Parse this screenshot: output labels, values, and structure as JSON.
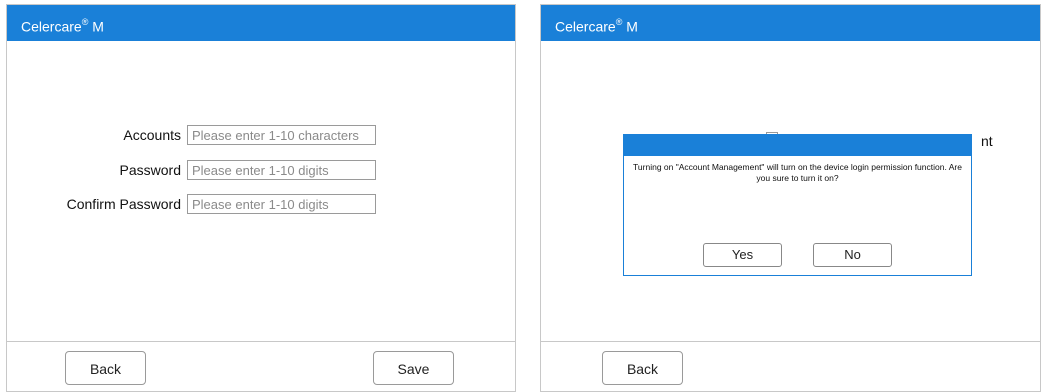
{
  "left_screen": {
    "app_title": "Celercare",
    "app_title_mark": "®",
    "app_title_suffix": "M",
    "form": {
      "accounts": {
        "label": "Accounts",
        "placeholder": "Please enter 1-10 characters",
        "value": ""
      },
      "password": {
        "label": "Password",
        "placeholder": "Please enter 1-10 digits",
        "value": ""
      },
      "confirm_password": {
        "label": "Confirm Password",
        "placeholder": "Please enter 1-10 digits",
        "value": ""
      }
    },
    "footer": {
      "back_label": "Back",
      "save_label": "Save"
    }
  },
  "right_screen": {
    "app_title": "Celercare",
    "app_title_mark": "®",
    "app_title_suffix": "M",
    "underlay_text_fragment": "nt",
    "dialog": {
      "message": "Turning on \"Account Management\" will turn on the device login permission function. Are you sure to turn it on?",
      "yes_label": "Yes",
      "no_label": "No"
    },
    "footer": {
      "back_label": "Back"
    }
  },
  "colors": {
    "accent": "#1a80d8",
    "border": "#c8c8c8"
  }
}
